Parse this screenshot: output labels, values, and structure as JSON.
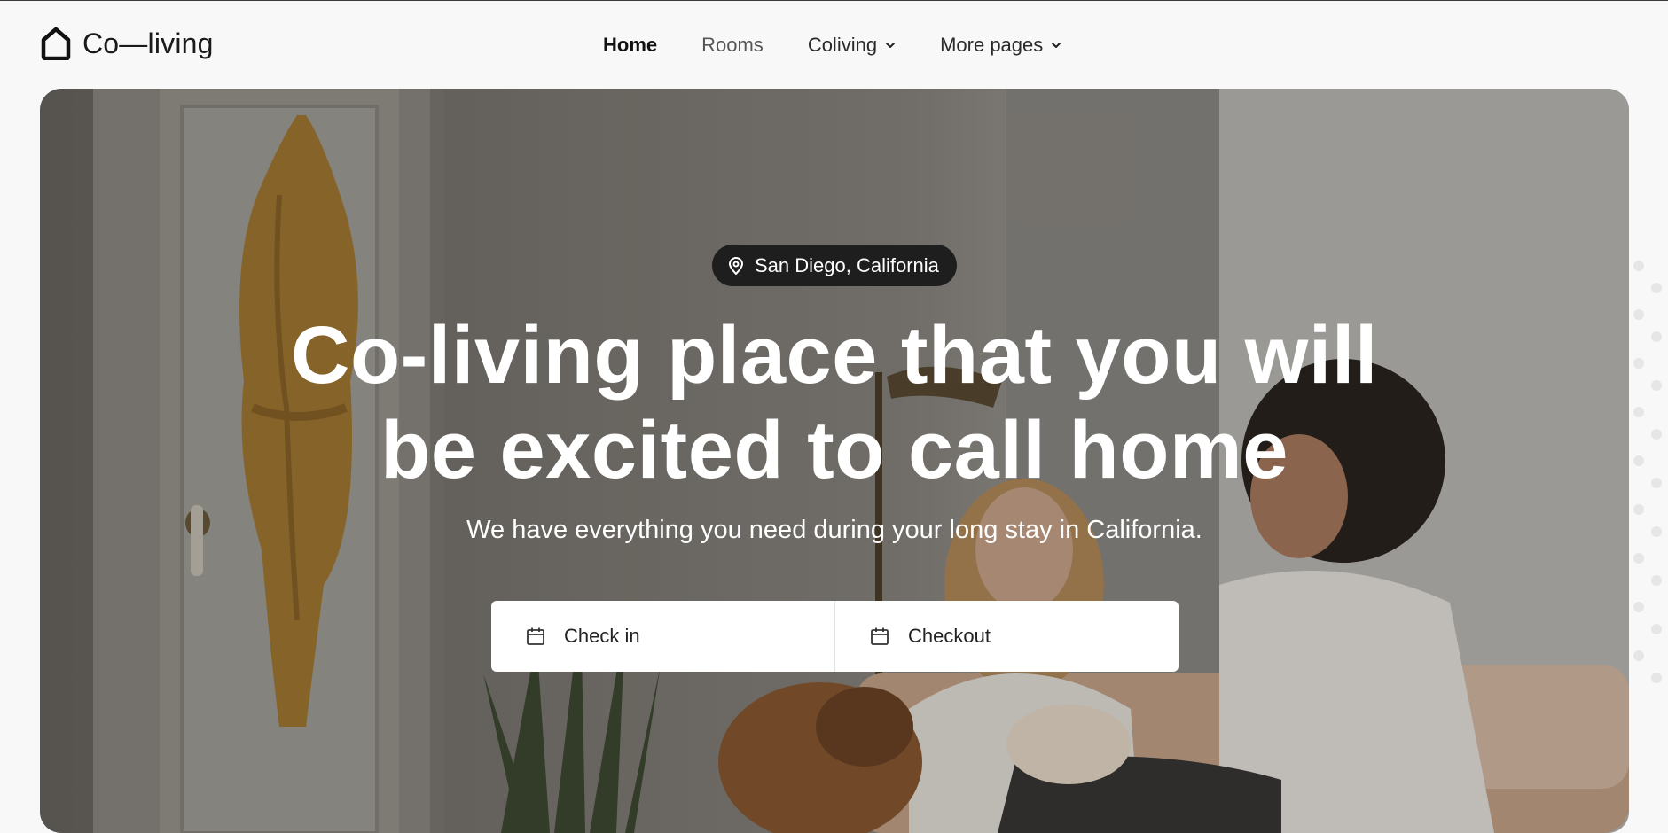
{
  "brand": {
    "logo_text": "Co—living"
  },
  "nav": {
    "items": [
      {
        "label": "Home",
        "active": true,
        "dropdown": false
      },
      {
        "label": "Rooms",
        "active": false,
        "dropdown": false
      },
      {
        "label": "Coliving",
        "active": false,
        "dropdown": true
      },
      {
        "label": "More pages",
        "active": false,
        "dropdown": true
      }
    ]
  },
  "hero": {
    "location": "San Diego, California",
    "headline_line1": "Co-living place that you will",
    "headline_line2": "be excited to call home",
    "subtitle": "We have everything you need during your long stay in California.",
    "booking": {
      "check_in_label": "Check in",
      "checkout_label": "Checkout"
    }
  },
  "icons": {
    "logo": "house-icon",
    "location": "map-pin-icon",
    "date": "calendar-icon",
    "dropdown": "chevron-down-icon"
  },
  "colors": {
    "page_bg": "#f8f8f8",
    "pill_bg": "#1e1e1e",
    "text_dark": "#1a1a1a",
    "hero_text": "#ffffff"
  }
}
